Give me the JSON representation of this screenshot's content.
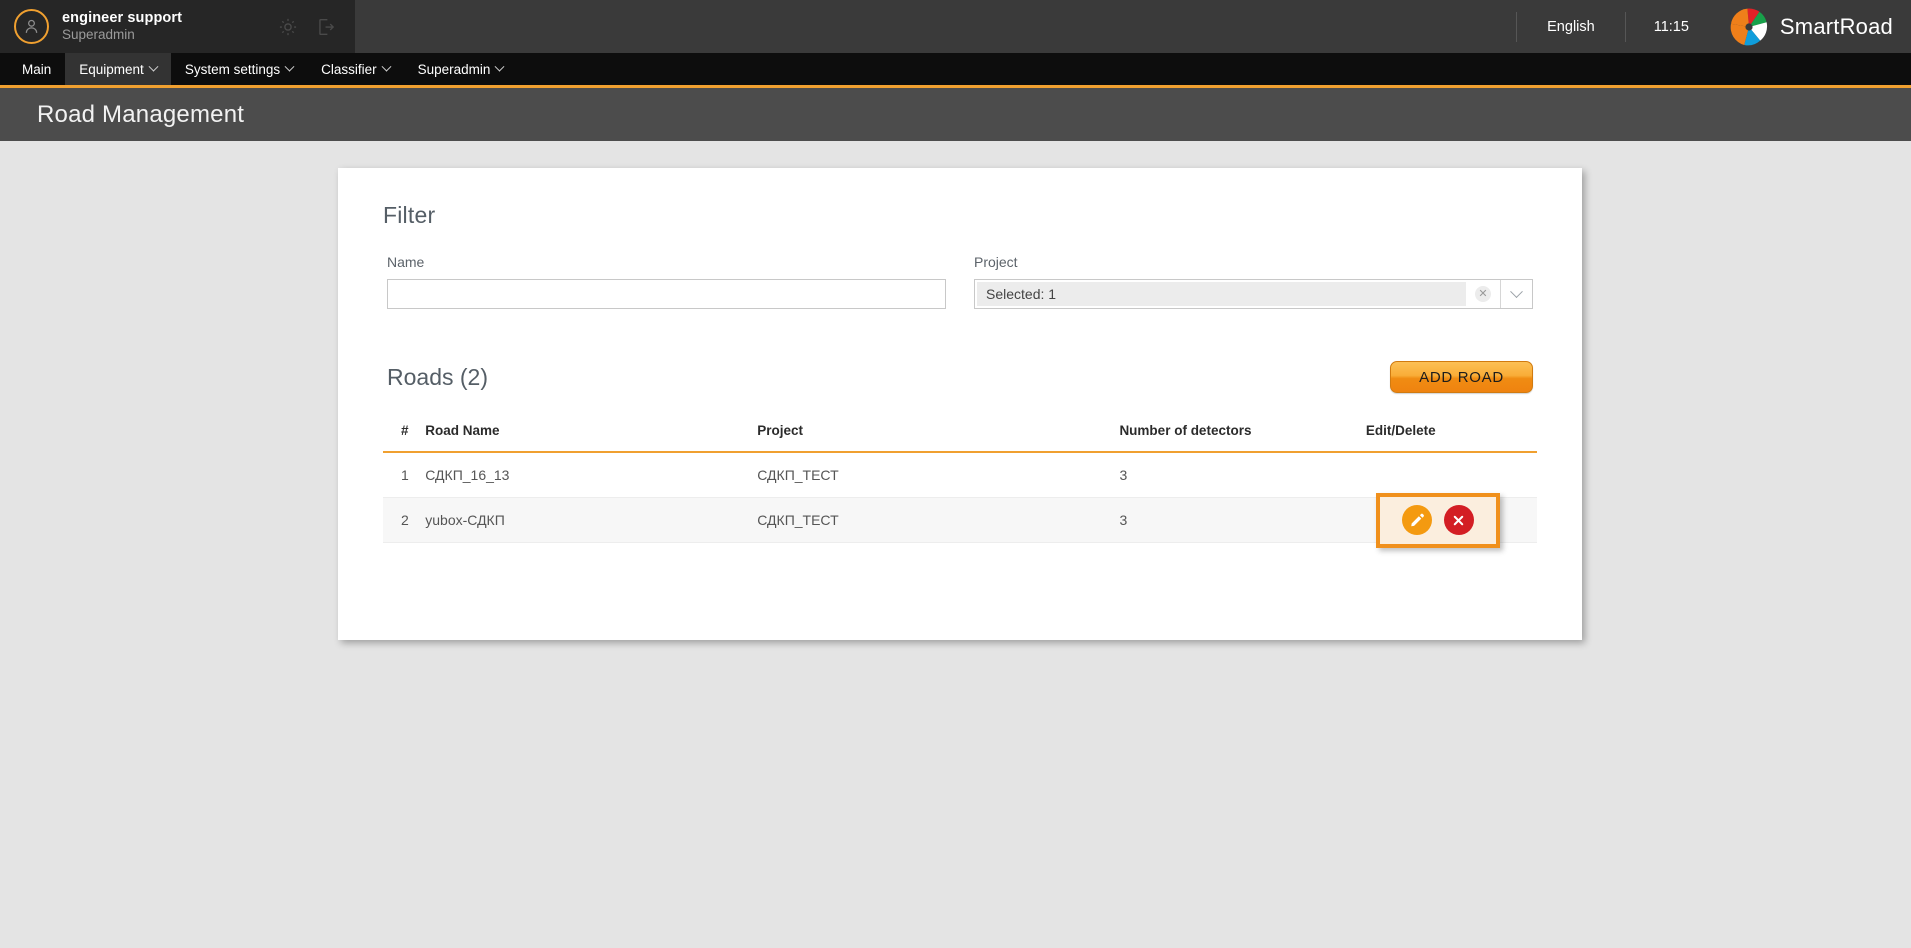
{
  "topbar": {
    "user_name": "engineer support",
    "user_role": "Superadmin",
    "avatar_icon": "user-avatar-icon",
    "settings_icon": "gear-icon",
    "logout_icon": "logout-icon",
    "language": "English",
    "time": "11:15",
    "brand_name": "SmartRoad",
    "brand_logo_icon": "smartroad-pinwheel-logo"
  },
  "nav": {
    "items": [
      {
        "label": "Main",
        "has_caret": false,
        "active": false
      },
      {
        "label": "Equipment",
        "has_caret": true,
        "active": true
      },
      {
        "label": "System settings",
        "has_caret": true,
        "active": false
      },
      {
        "label": "Classifier",
        "has_caret": true,
        "active": false
      },
      {
        "label": "Superadmin",
        "has_caret": true,
        "active": false
      }
    ]
  },
  "page": {
    "title": "Road Management"
  },
  "filter": {
    "title": "Filter",
    "name_label": "Name",
    "name_value": "",
    "name_placeholder": "",
    "project_label": "Project",
    "project_value": "Selected: 1",
    "project_clear_icon": "clear-x-icon",
    "project_toggle_icon": "chevron-down-icon"
  },
  "roads": {
    "title": "Roads (2)",
    "add_button": "ADD ROAD",
    "columns": [
      "#",
      "Road Name",
      "Project",
      "Number of detectors",
      "Edit/Delete"
    ],
    "rows": [
      {
        "num": "1",
        "name": "СДКП_16_13",
        "project": "СДКП_ТЕСТ",
        "detectors": "3"
      },
      {
        "num": "2",
        "name": "yubox-СДКП",
        "project": "СДКП_ТЕСТ",
        "detectors": "3"
      }
    ],
    "edit_icon": "pencil-edit-icon",
    "delete_icon": "close-x-delete-icon"
  },
  "colors": {
    "accent_orange": "#f0a030",
    "header_dark": "#3a3a3a",
    "nav_black": "#0d0d0d",
    "title_bar": "#4c4c4c",
    "delete_red": "#d31e24",
    "edit_orange": "#f49a10",
    "highlight_border": "#f0901c",
    "highlight_fill": "#fbeede"
  }
}
